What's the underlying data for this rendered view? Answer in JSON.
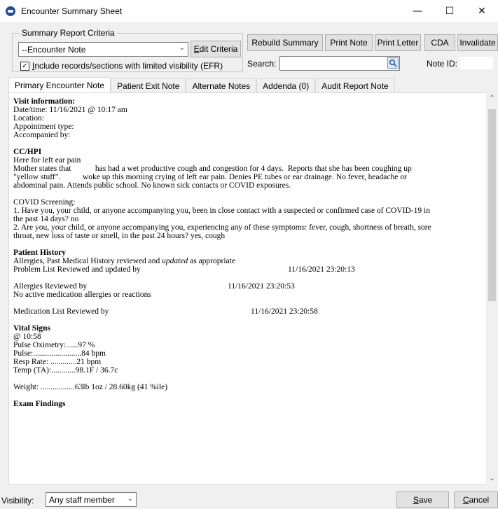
{
  "window": {
    "title": "Encounter Summary Sheet",
    "minimize": "—",
    "maximize": "☐",
    "close": "✕"
  },
  "criteria": {
    "legend": "Summary Report Criteria",
    "selected": "--Encounter Note",
    "edit_key": "E",
    "edit_rest": "dit Criteria",
    "include_key": "I",
    "include_rest": "nclude records/sections with limited visibility (EFR)",
    "include_checked": "✓"
  },
  "toolbar": {
    "rebuild": "Rebuild Summary",
    "print_note": "Print Note",
    "print_letter": "Print Letter",
    "cda": "CDA",
    "invalidate": "Invalidate",
    "search_label": "Search:",
    "noteid_label": "Note ID:"
  },
  "tabs": [
    "Primary Encounter Note",
    "Patient Exit Note",
    "Alternate Notes",
    "Addenda (0)",
    "Audit Report Note"
  ],
  "note": {
    "visit_heading": "Visit information:",
    "visit_lines": [
      "Date/time: 11/16/2021 @ 10:17 am",
      "Location:",
      "Appointment type:",
      "Accompanied by:"
    ],
    "cchpi_heading": "CC/HPI",
    "cchpi_lines": [
      "Here for left ear pain",
      "Mother states that            has had a wet productive cough and congestion for 4 days.  Reports that she has been coughing up",
      "\"yellow stuff\".           woke up this morning crying of left ear pain. Denies PE tubes or ear drainage. No fever, headache or",
      "abdominal pain. Attends public school.  No known sick contacts or COVID exposures."
    ],
    "covid_lines": [
      "COVID Screening:",
      "1. Have you, your child, or anyone accompanying you, been in close contact with a suspected or confirmed case of COVID-19 in",
      "the past 14 days? no",
      "2. Are you, your child, or anyone accompanying you, experiencing any of these symptoms: fever, cough, shortness of breath, sore",
      "throat, new loss of taste or smell, in the past 24 hours? yes, cough"
    ],
    "history_heading": "Patient History",
    "history_line1_pre": "Allergies, Past Medical History reviewed and ",
    "history_line1_em": "updated",
    "history_line1_post": " as appropriate",
    "problem_label": "Problem List Reviewed and updated by",
    "problem_time": "11/16/2021 23:20:13",
    "allergies_label": "Allergies Reviewed by",
    "allergies_time": "11/16/2021 23:20:53",
    "allergies_note": "No active medication allergies or reactions",
    "medlist_label": "Medication List Reviewed by",
    "medlist_time": "11/16/2021 23:20:58",
    "vitals_heading": "Vital Signs",
    "vitals_lines": [
      "@ 10:58",
      "Pulse Oximetry:......97 %",
      "Pulse:........................84 bpm",
      "Resp Rate: .............21 bpm",
      "Temp (TA):............98.1F / 36.7c"
    ],
    "weight_line": "Weight: .................63lb 1oz / 28.60kg (41 %ile)",
    "exam_heading": "Exam Findings"
  },
  "footer": {
    "visibility_label": "Visibility:",
    "visibility_value": "Any staff member",
    "save_key": "S",
    "save_rest": "ave",
    "cancel_key": "C",
    "cancel_rest": "ancel"
  }
}
